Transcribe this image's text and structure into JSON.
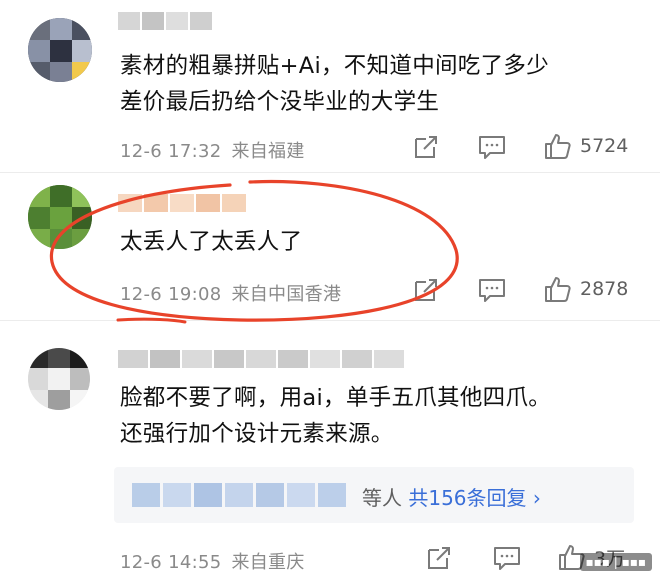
{
  "comments": [
    {
      "text": "素材的粗暴拼贴+Ai，不知道中间吃了多少\n差价最后扔给个没毕业的大学生",
      "time": "12-6 17:32",
      "location": "来自福建",
      "likes": "5724"
    },
    {
      "text": "太丢人了太丢人了",
      "time": "12-6 19:08",
      "location": "来自中国香港",
      "likes": "2878"
    },
    {
      "text": "脸都不要了啊，用ai，单手五爪其他四爪。\n还强行加个设计元素来源。",
      "time": "12-6 14:55",
      "location": "来自重庆",
      "likes": "3万",
      "replies": {
        "suffix": "等人",
        "link": "共156条回复 ›"
      }
    }
  ],
  "icons": {
    "repost": "repost-icon",
    "comment": "comment-icon",
    "like": "thumbs-up-icon"
  },
  "colors": {
    "annotation_circle": "#e8432a",
    "link": "#3a6fd8",
    "meta_text": "#8a8a8a"
  }
}
